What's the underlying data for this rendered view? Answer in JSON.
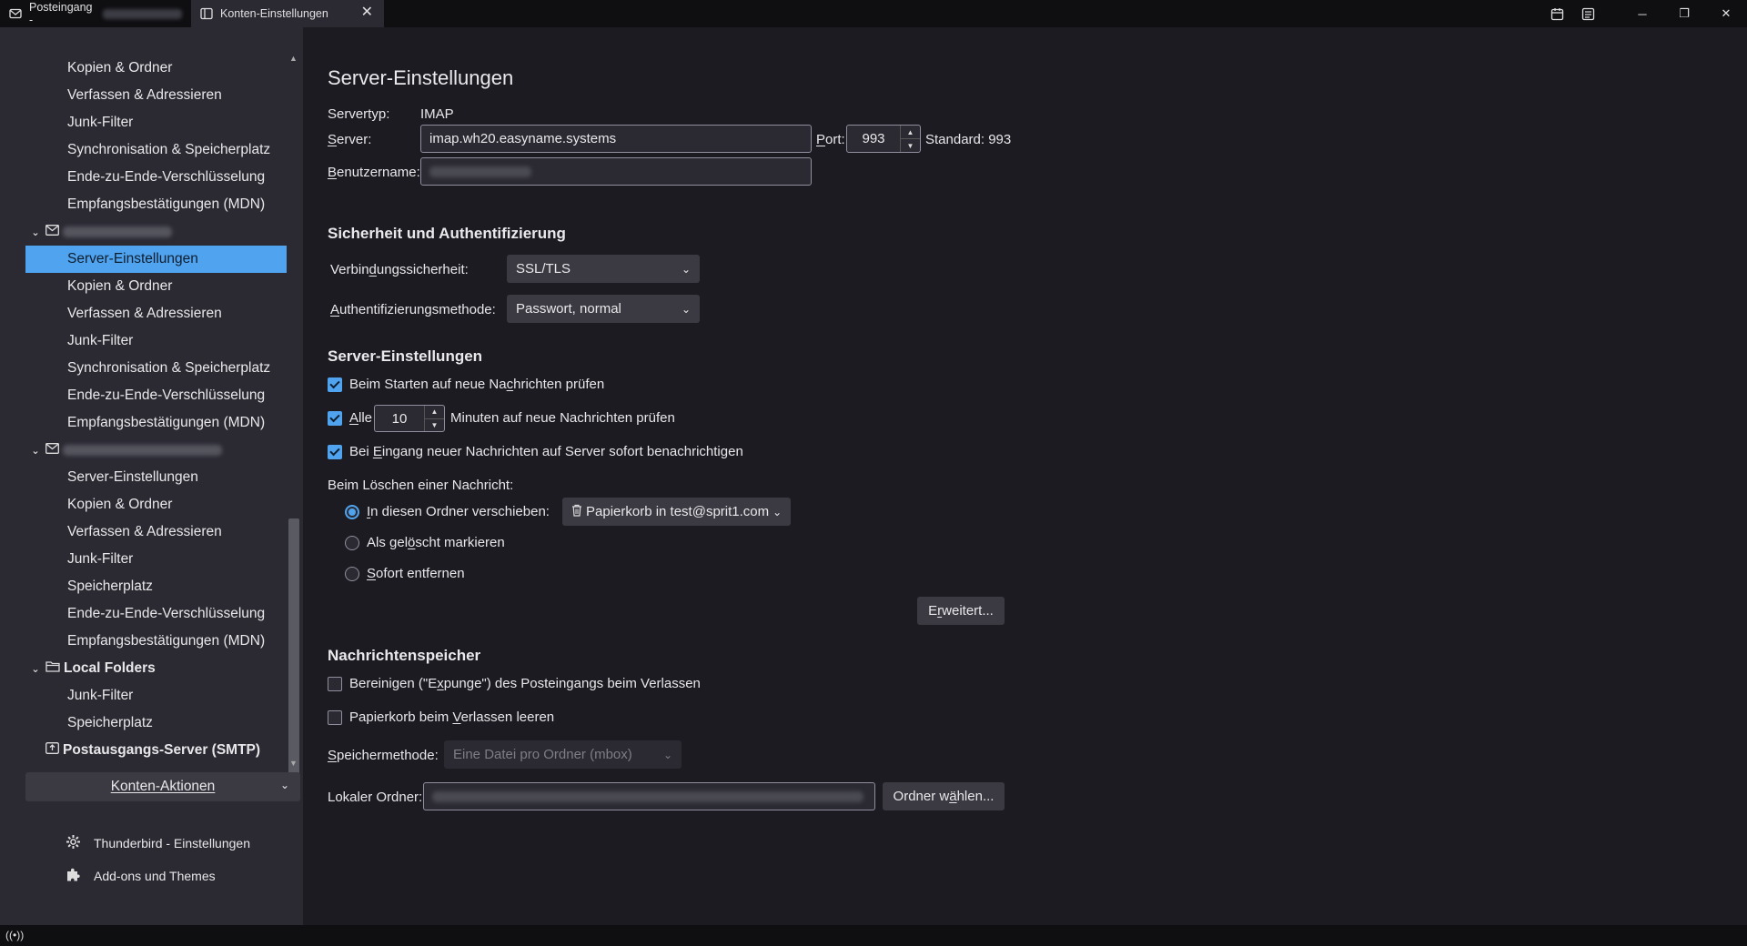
{
  "tabs": [
    {
      "label": "Posteingang - ",
      "icon": "mail-icon",
      "active": false
    },
    {
      "label": "Konten-Einstellungen",
      "icon": "settings-tab-icon",
      "active": true
    }
  ],
  "sidebar": {
    "group1_items": [
      "Kopien & Ordner",
      "Verfassen & Adressieren",
      "Junk-Filter",
      "Synchronisation & Speicherplatz",
      "Ende-zu-Ende-Verschlüsselung",
      "Empfangsbestätigungen (MDN)"
    ],
    "account2_items": [
      "Server-Einstellungen",
      "Kopien & Ordner",
      "Verfassen & Adressieren",
      "Junk-Filter",
      "Synchronisation & Speicherplatz",
      "Ende-zu-Ende-Verschlüsselung",
      "Empfangsbestätigungen (MDN)"
    ],
    "account3_items": [
      "Server-Einstellungen",
      "Kopien & Ordner",
      "Verfassen & Adressieren",
      "Junk-Filter",
      "Speicherplatz",
      "Ende-zu-Ende-Verschlüsselung",
      "Empfangsbestätigungen (MDN)"
    ],
    "local_folders": {
      "label": "Local Folders",
      "items": [
        "Junk-Filter",
        "Speicherplatz"
      ]
    },
    "smtp": "Postausgangs-Server (SMTP)",
    "account_actions": "Konten-Aktionen",
    "footer": {
      "settings": "Thunderbird - Einstellungen",
      "addons": "Add-ons und Themes"
    }
  },
  "main": {
    "title": "Server-Einstellungen",
    "servertype_label": "Servertyp:",
    "servertype_value": "IMAP",
    "server_label": "Server:",
    "server_value": "imap.wh20.easyname.systems",
    "port_label": "Port:",
    "port_value": "993",
    "port_default": "Standard: 993",
    "username_label": "Benutzername:",
    "security": {
      "heading": "Sicherheit und Authentifizierung",
      "connection_label": "Verbindungssicherheit:",
      "connection_value": "SSL/TLS",
      "auth_label": "Authentifizierungsmethode:",
      "auth_value": "Passwort, normal"
    },
    "server_settings": {
      "heading": "Server-Einstellungen",
      "check_startup": "Beim Starten auf neue Nachrichten prüfen",
      "check_every_prefix": "Alle",
      "check_every_value": "10",
      "check_every_suffix": "Minuten auf neue Nachrichten prüfen",
      "notify_new": "Bei Eingang neuer Nachrichten auf Server sofort benachrichtigen",
      "on_delete_label": "Beim Löschen einer Nachricht:",
      "move_to_folder": "In diesen Ordner verschieben:",
      "trash_folder": "Papierkorb in test@sprit1.com",
      "mark_deleted": "Als gelöscht markieren",
      "remove_now": "Sofort entfernen",
      "advanced_button": "Erweitert..."
    },
    "storage": {
      "heading": "Nachrichtenspeicher",
      "expunge": "Bereinigen (\"Expunge\") des Posteingangs beim Verlassen",
      "empty_trash": "Papierkorb beim Verlassen leeren",
      "method_label": "Speichermethode:",
      "method_value": "Eine Datei pro Ordner (mbox)",
      "local_folder_label": "Lokaler Ordner:",
      "choose_folder_button": "Ordner wählen..."
    }
  },
  "colors": {
    "accent": "#4fa3ef",
    "sidebar_bg": "#2b2a33",
    "main_bg": "#1c1b22"
  }
}
